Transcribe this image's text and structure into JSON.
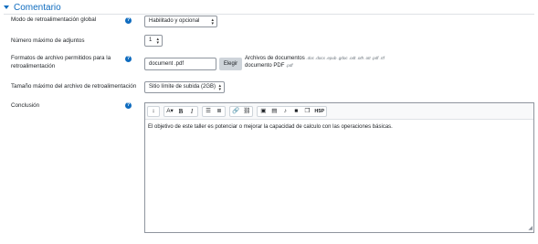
{
  "section": {
    "title": "Comentario"
  },
  "rows": {
    "mode": {
      "label": "Modo de retroalimentación global",
      "value": "Habilitado y opcional"
    },
    "attachments": {
      "label": "Número máximo de adjuntos",
      "value": "1"
    },
    "filetypes": {
      "label_line1": "Formatos de archivo permitidos para la",
      "label_line2": "retroalimentación",
      "value": "document .pdf",
      "button": "Elegir",
      "desc_line1": "Archivos de documentos",
      "desc_line1_ext": ".doc .docx .epub .gdoc .odt .oth .ott .pdf .rtf",
      "desc_line2": "documento PDF",
      "desc_line2_ext": ".pdf"
    },
    "maxsize": {
      "label": "Tamaño máximo del archivo de retroalimentación",
      "value": "Sitio límite de subida (2GB)"
    },
    "conclusion": {
      "label": "Conclusión",
      "content": "El objetivo de este taller es potenciar o mejorar la capacidad de calculo con las operaciones básicas."
    }
  },
  "toolbar": {
    "collapse": "↕",
    "style": "A▾",
    "bold": "B",
    "italic": "I",
    "bullets": "☰",
    "numbered": "≣",
    "link": "🔗",
    "unlink": "⛓",
    "image": "▣",
    "media": "▤",
    "record_audio": "♪",
    "record_video": "■",
    "manage_files": "❐",
    "h5p": "H5P"
  },
  "colors": {
    "accent": "#0f6cbf",
    "border": "#8f959e",
    "button": "#ced4da"
  }
}
